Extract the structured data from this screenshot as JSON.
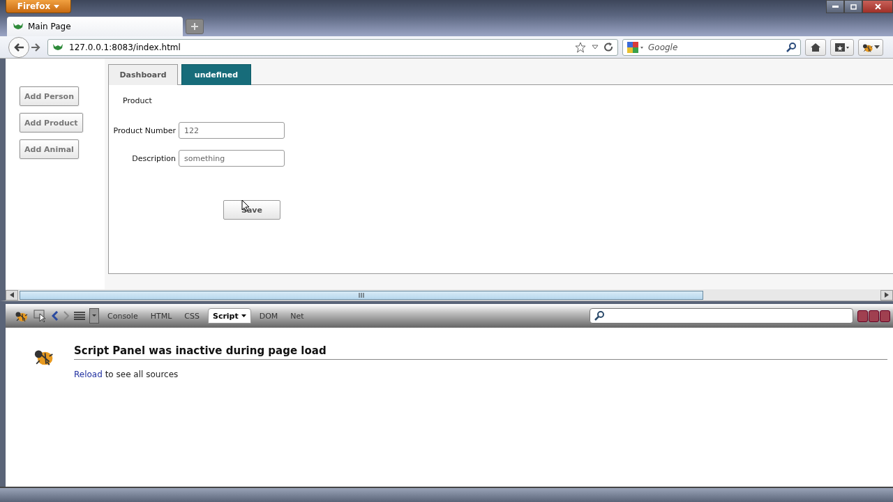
{
  "browser": {
    "menu_button": "Firefox",
    "tab_title": "Main Page",
    "address": "127.0.0.1:8083/index.html",
    "search_placeholder": "Google"
  },
  "sidebar": {
    "buttons": [
      "Add Person",
      "Add Product",
      "Add Animal"
    ]
  },
  "tabs": [
    {
      "label": "Dashboard",
      "selected": false
    },
    {
      "label": "undefined",
      "selected": true
    }
  ],
  "form": {
    "title": "Product",
    "fields": [
      {
        "label": "Product Number",
        "value": "122"
      },
      {
        "label": "Description",
        "value": "something"
      }
    ],
    "save_button": "Save"
  },
  "firebug": {
    "tabs": [
      {
        "label": "Console",
        "selected": false
      },
      {
        "label": "HTML",
        "selected": false
      },
      {
        "label": "CSS",
        "selected": false
      },
      {
        "label": "Script",
        "selected": true
      },
      {
        "label": "DOM",
        "selected": false
      },
      {
        "label": "Net",
        "selected": false
      }
    ],
    "heading": "Script Panel was inactive during page load",
    "reload_link": "Reload",
    "reload_text": "to see all sources"
  }
}
